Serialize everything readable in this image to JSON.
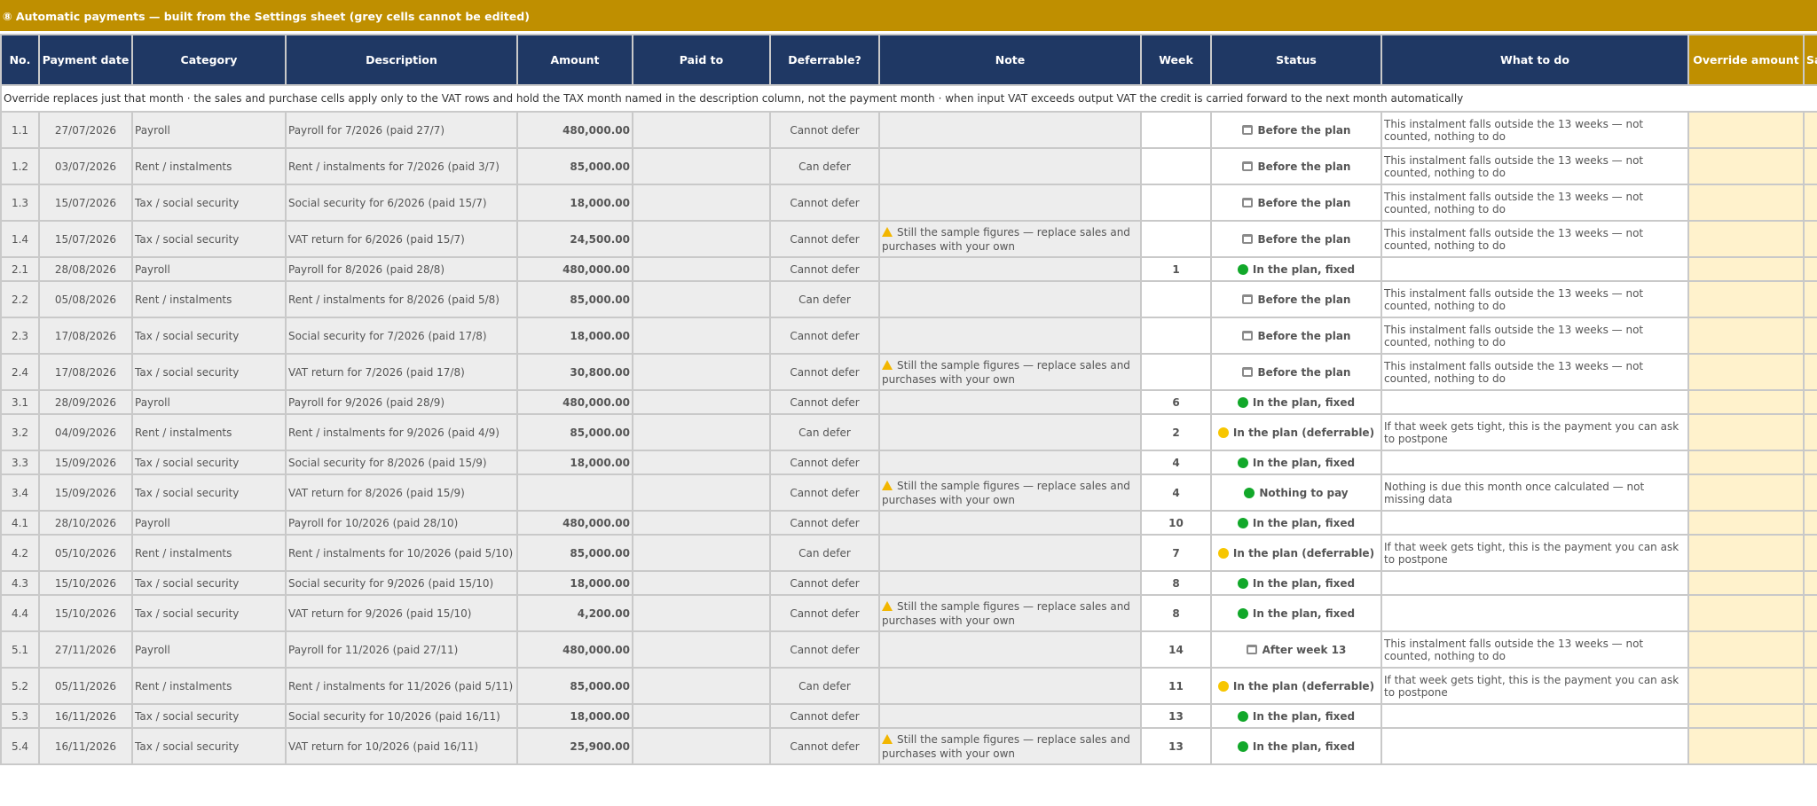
{
  "title": "⑧ Automatic payments — built from the Settings sheet (grey cells cannot be edited)",
  "columns": {
    "no": "No.",
    "date": "Payment date",
    "category": "Category",
    "description": "Description",
    "amount": "Amount",
    "paid_to": "Paid to",
    "deferrable": "Deferrable?",
    "note": "Note",
    "week": "Week",
    "status": "Status",
    "todo": "What to do",
    "override": "Override amount",
    "extra": "Sa"
  },
  "instruction": "Override replaces just that month · the sales and purchase cells apply only to the VAT rows and hold the TAX month named in the description column, not the payment month · when input VAT exceeds output VAT the credit is carried forward to the next month automatically",
  "colors": {
    "header": "#1f3864",
    "gold": "#bf8f00",
    "override_fill": "#fff2cc",
    "green": "#12a82a",
    "yellow": "#f7c600"
  },
  "rows": [
    {
      "no": "1.1",
      "date": "27/07/2026",
      "category": "Payroll",
      "description": "Payroll for 7/2026 (paid 27/7)",
      "amount": "480,000.00",
      "deferrable": "Cannot defer",
      "note": "",
      "week": "",
      "status": "Before the plan",
      "status_icon": "calendar-icon",
      "todo": "This instalment falls outside the 13 weeks — not counted, nothing to do"
    },
    {
      "no": "1.2",
      "date": "03/07/2026",
      "category": "Rent / instalments",
      "description": "Rent / instalments for 7/2026 (paid 3/7)",
      "amount": "85,000.00",
      "deferrable": "Can defer",
      "note": "",
      "week": "",
      "status": "Before the plan",
      "status_icon": "calendar-icon",
      "todo": "This instalment falls outside the 13 weeks — not counted, nothing to do"
    },
    {
      "no": "1.3",
      "date": "15/07/2026",
      "category": "Tax / social security",
      "description": "Social security for 6/2026 (paid 15/7)",
      "amount": "18,000.00",
      "deferrable": "Cannot defer",
      "note": "",
      "week": "",
      "status": "Before the plan",
      "status_icon": "calendar-icon",
      "todo": "This instalment falls outside the 13 weeks — not counted, nothing to do"
    },
    {
      "no": "1.4",
      "date": "15/07/2026",
      "category": "Tax / social security",
      "description": "VAT return for 6/2026 (paid 15/7)",
      "amount": "24,500.00",
      "deferrable": "Cannot defer",
      "note": "Still the sample figures — replace sales and purchases with your own",
      "week": "",
      "status": "Before the plan",
      "status_icon": "calendar-icon",
      "todo": "This instalment falls outside the 13 weeks — not counted, nothing to do"
    },
    {
      "no": "2.1",
      "date": "28/08/2026",
      "category": "Payroll",
      "description": "Payroll for 8/2026 (paid 28/8)",
      "amount": "480,000.00",
      "deferrable": "Cannot defer",
      "note": "",
      "week": "1",
      "status": "In the plan, fixed",
      "status_icon": "green-dot-icon",
      "todo": ""
    },
    {
      "no": "2.2",
      "date": "05/08/2026",
      "category": "Rent / instalments",
      "description": "Rent / instalments for 8/2026 (paid 5/8)",
      "amount": "85,000.00",
      "deferrable": "Can defer",
      "note": "",
      "week": "",
      "status": "Before the plan",
      "status_icon": "calendar-icon",
      "todo": "This instalment falls outside the 13 weeks — not counted, nothing to do"
    },
    {
      "no": "2.3",
      "date": "17/08/2026",
      "category": "Tax / social security",
      "description": "Social security for 7/2026 (paid 17/8)",
      "amount": "18,000.00",
      "deferrable": "Cannot defer",
      "note": "",
      "week": "",
      "status": "Before the plan",
      "status_icon": "calendar-icon",
      "todo": "This instalment falls outside the 13 weeks — not counted, nothing to do"
    },
    {
      "no": "2.4",
      "date": "17/08/2026",
      "category": "Tax / social security",
      "description": "VAT return for 7/2026 (paid 17/8)",
      "amount": "30,800.00",
      "deferrable": "Cannot defer",
      "note": "Still the sample figures — replace sales and purchases with your own",
      "week": "",
      "status": "Before the plan",
      "status_icon": "calendar-icon",
      "todo": "This instalment falls outside the 13 weeks — not counted, nothing to do"
    },
    {
      "no": "3.1",
      "date": "28/09/2026",
      "category": "Payroll",
      "description": "Payroll for 9/2026 (paid 28/9)",
      "amount": "480,000.00",
      "deferrable": "Cannot defer",
      "note": "",
      "week": "6",
      "status": "In the plan, fixed",
      "status_icon": "green-dot-icon",
      "todo": ""
    },
    {
      "no": "3.2",
      "date": "04/09/2026",
      "category": "Rent / instalments",
      "description": "Rent / instalments for 9/2026 (paid 4/9)",
      "amount": "85,000.00",
      "deferrable": "Can defer",
      "note": "",
      "week": "2",
      "status": "In the plan (deferrable)",
      "status_icon": "yellow-dot-icon",
      "todo": "If that week gets tight, this is the payment you can ask to postpone"
    },
    {
      "no": "3.3",
      "date": "15/09/2026",
      "category": "Tax / social security",
      "description": "Social security for 8/2026 (paid 15/9)",
      "amount": "18,000.00",
      "deferrable": "Cannot defer",
      "note": "",
      "week": "4",
      "status": "In the plan, fixed",
      "status_icon": "green-dot-icon",
      "todo": ""
    },
    {
      "no": "3.4",
      "date": "15/09/2026",
      "category": "Tax / social security",
      "description": "VAT return for 8/2026 (paid 15/9)",
      "amount": "",
      "deferrable": "Cannot defer",
      "note": "Still the sample figures — replace sales and purchases with your own",
      "week": "4",
      "status": "Nothing to pay",
      "status_icon": "green-dot-icon",
      "todo": "Nothing is due this month once calculated — not missing data"
    },
    {
      "no": "4.1",
      "date": "28/10/2026",
      "category": "Payroll",
      "description": "Payroll for 10/2026 (paid 28/10)",
      "amount": "480,000.00",
      "deferrable": "Cannot defer",
      "note": "",
      "week": "10",
      "status": "In the plan, fixed",
      "status_icon": "green-dot-icon",
      "todo": ""
    },
    {
      "no": "4.2",
      "date": "05/10/2026",
      "category": "Rent / instalments",
      "description": "Rent / instalments for 10/2026 (paid 5/10)",
      "amount": "85,000.00",
      "deferrable": "Can defer",
      "note": "",
      "week": "7",
      "status": "In the plan (deferrable)",
      "status_icon": "yellow-dot-icon",
      "todo": "If that week gets tight, this is the payment you can ask to postpone"
    },
    {
      "no": "4.3",
      "date": "15/10/2026",
      "category": "Tax / social security",
      "description": "Social security for 9/2026 (paid 15/10)",
      "amount": "18,000.00",
      "deferrable": "Cannot defer",
      "note": "",
      "week": "8",
      "status": "In the plan, fixed",
      "status_icon": "green-dot-icon",
      "todo": ""
    },
    {
      "no": "4.4",
      "date": "15/10/2026",
      "category": "Tax / social security",
      "description": "VAT return for 9/2026 (paid 15/10)",
      "amount": "4,200.00",
      "deferrable": "Cannot defer",
      "note": "Still the sample figures — replace sales and purchases with your own",
      "week": "8",
      "status": "In the plan, fixed",
      "status_icon": "green-dot-icon",
      "todo": ""
    },
    {
      "no": "5.1",
      "date": "27/11/2026",
      "category": "Payroll",
      "description": "Payroll for 11/2026 (paid 27/11)",
      "amount": "480,000.00",
      "deferrable": "Cannot defer",
      "note": "",
      "week": "14",
      "status": "After week 13",
      "status_icon": "calendar-icon",
      "todo": "This instalment falls outside the 13 weeks — not counted, nothing to do"
    },
    {
      "no": "5.2",
      "date": "05/11/2026",
      "category": "Rent / instalments",
      "description": "Rent / instalments for 11/2026 (paid 5/11)",
      "amount": "85,000.00",
      "deferrable": "Can defer",
      "note": "",
      "week": "11",
      "status": "In the plan (deferrable)",
      "status_icon": "yellow-dot-icon",
      "todo": "If that week gets tight, this is the payment you can ask to postpone"
    },
    {
      "no": "5.3",
      "date": "16/11/2026",
      "category": "Tax / social security",
      "description": "Social security for 10/2026 (paid 16/11)",
      "amount": "18,000.00",
      "deferrable": "Cannot defer",
      "note": "",
      "week": "13",
      "status": "In the plan, fixed",
      "status_icon": "green-dot-icon",
      "todo": ""
    },
    {
      "no": "5.4",
      "date": "16/11/2026",
      "category": "Tax / social security",
      "description": "VAT return for 10/2026 (paid 16/11)",
      "amount": "25,900.00",
      "deferrable": "Cannot defer",
      "note": "Still the sample figures — replace sales and purchases with your own",
      "week": "13",
      "status": "In the plan, fixed",
      "status_icon": "green-dot-icon",
      "todo": ""
    }
  ]
}
